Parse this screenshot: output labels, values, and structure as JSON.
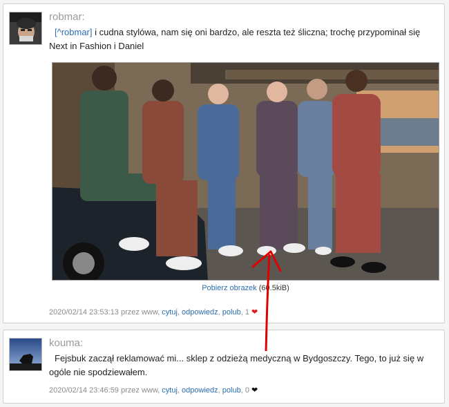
{
  "posts": [
    {
      "author": "robmar:",
      "quote_link": "[^robmar]",
      "text": " i cudna stylówa, nam się oni bardzo, ale reszta też śliczna; trochę przypominał się Next in Fashion i Daniel",
      "image_alt": "Men in plaid tracksuits",
      "download_label": "Pobierz obrazek",
      "download_size": "(60.5kiB)",
      "timestamp": "2020/02/14 23:53:13 przez www,",
      "actions": {
        "quote": "cytuj",
        "reply": "odpowiedz",
        "like": "polub"
      },
      "like_count": "1",
      "heart": "❤"
    },
    {
      "author": "kouma:",
      "text": "Fejsbuk zaczął reklamować mi... sklep z odzieżą medyczną w Bydgoszczy. Tego, to już się w ogóle nie spodziewałem.",
      "timestamp": "2020/02/14 23:46:59 przez www,",
      "actions": {
        "quote": "cytuj",
        "reply": "odpowiedz",
        "like": "polub"
      },
      "like_count": "0",
      "heart": "❤"
    }
  ],
  "colors": {
    "link": "#2a6db0",
    "arrow": "#e00000",
    "heart_active": "#e01b1b"
  }
}
